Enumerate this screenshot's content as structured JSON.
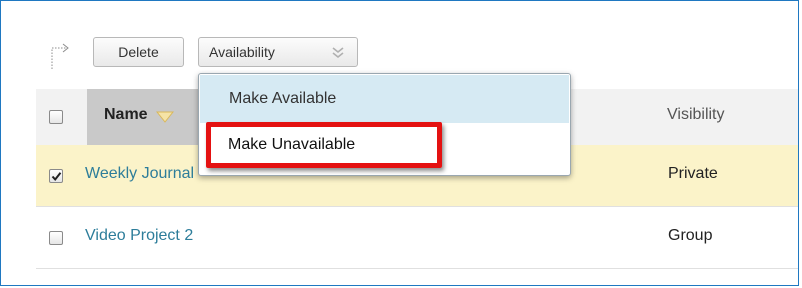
{
  "toolbar": {
    "delete_label": "Delete",
    "availability_label": "Availability",
    "chevron_icon": "double-chevron-down-icon",
    "arrow_icon": "dotted-corner-arrow-icon"
  },
  "table": {
    "header": {
      "name_label": "Name",
      "visibility_label": "Visibility",
      "select_all_checked": false
    },
    "rows": [
      {
        "title": "Weekly Journal",
        "visibility": "Private",
        "checked": true
      },
      {
        "title": "Video Project 2",
        "visibility": "Group",
        "checked": false
      }
    ]
  },
  "availability_menu": {
    "items": [
      {
        "label": "Make Available"
      },
      {
        "label": "Make Unavailable"
      }
    ]
  },
  "colors": {
    "frame_border": "#1f78c1",
    "selected_row": "#fbf3c9",
    "link": "#2d7d9a",
    "menu_hover": "#d6eaf3",
    "callout_red": "#e41111"
  }
}
